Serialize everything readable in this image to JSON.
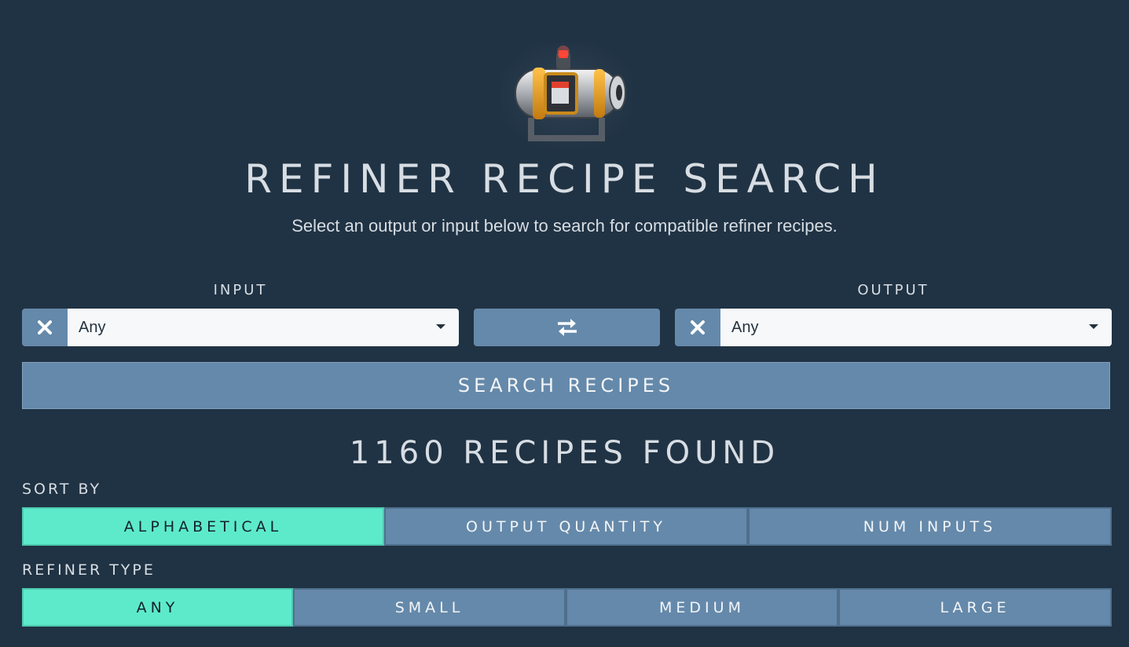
{
  "header": {
    "title": "REFINER RECIPE SEARCH",
    "subtitle": "Select an output or input below to search for compatible refiner recipes."
  },
  "input": {
    "label": "INPUT",
    "value": "Any"
  },
  "output": {
    "label": "OUTPUT",
    "value": "Any"
  },
  "search_button": "SEARCH RECIPES",
  "results": {
    "found_text": "1160 RECIPES FOUND"
  },
  "sort": {
    "label": "SORT BY",
    "options": [
      "ALPHABETICAL",
      "OUTPUT QUANTITY",
      "NUM INPUTS"
    ],
    "selected": "ALPHABETICAL"
  },
  "refiner_type": {
    "label": "REFINER TYPE",
    "options": [
      "ANY",
      "SMALL",
      "MEDIUM",
      "LARGE"
    ],
    "selected": "ANY"
  },
  "colors": {
    "background": "#203344",
    "button": "#6589aa",
    "active": "#5deacb"
  },
  "icons": {
    "logo": "refiner-device-icon",
    "clear": "close-icon",
    "swap": "swap-arrows-icon",
    "dropdown": "caret-down-icon"
  }
}
